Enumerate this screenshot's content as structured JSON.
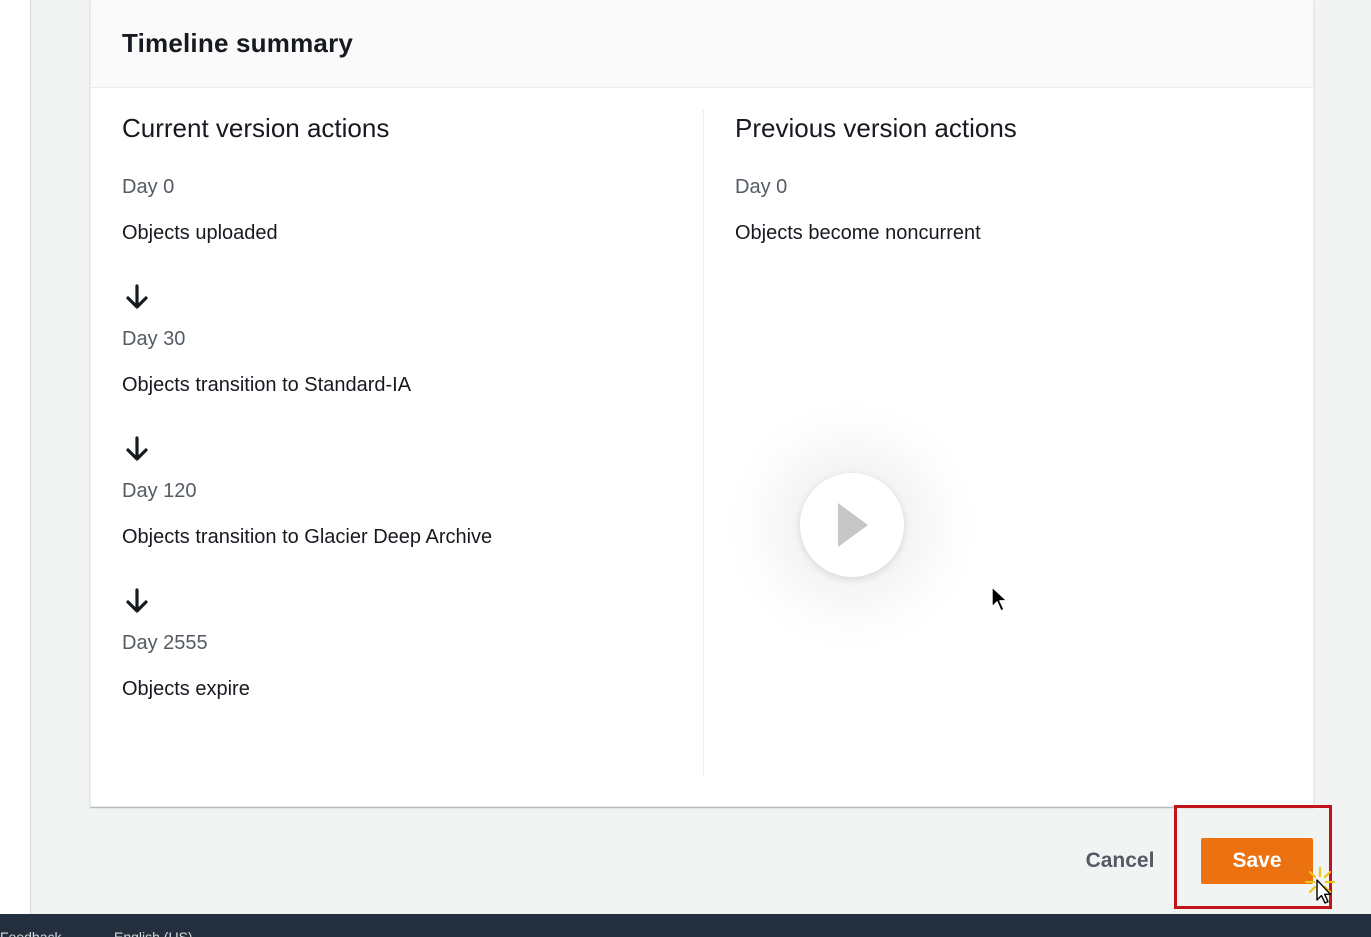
{
  "card": {
    "title": "Timeline summary"
  },
  "current_version": {
    "heading": "Current version actions",
    "steps": [
      {
        "day": "Day 0",
        "action": "Objects uploaded"
      },
      {
        "day": "Day 30",
        "action": "Objects transition to Standard-IA"
      },
      {
        "day": "Day 120",
        "action": "Objects transition to Glacier Deep Archive"
      },
      {
        "day": "Day 2555",
        "action": "Objects expire"
      }
    ]
  },
  "previous_version": {
    "heading": "Previous version actions",
    "steps": [
      {
        "day": "Day 0",
        "action": "Objects become noncurrent"
      }
    ]
  },
  "footer": {
    "cancel_label": "Cancel",
    "save_label": "Save"
  },
  "bottom_bar": {
    "feedback_label": "Feedback",
    "language_label": "English (US)"
  },
  "colors": {
    "primary_button": "#ec7211",
    "highlight_box": "#c0141d",
    "bottom_bar": "#232f3e"
  },
  "icons": [
    "arrow-down-icon",
    "play-icon",
    "mouse-cursor-icon"
  ]
}
